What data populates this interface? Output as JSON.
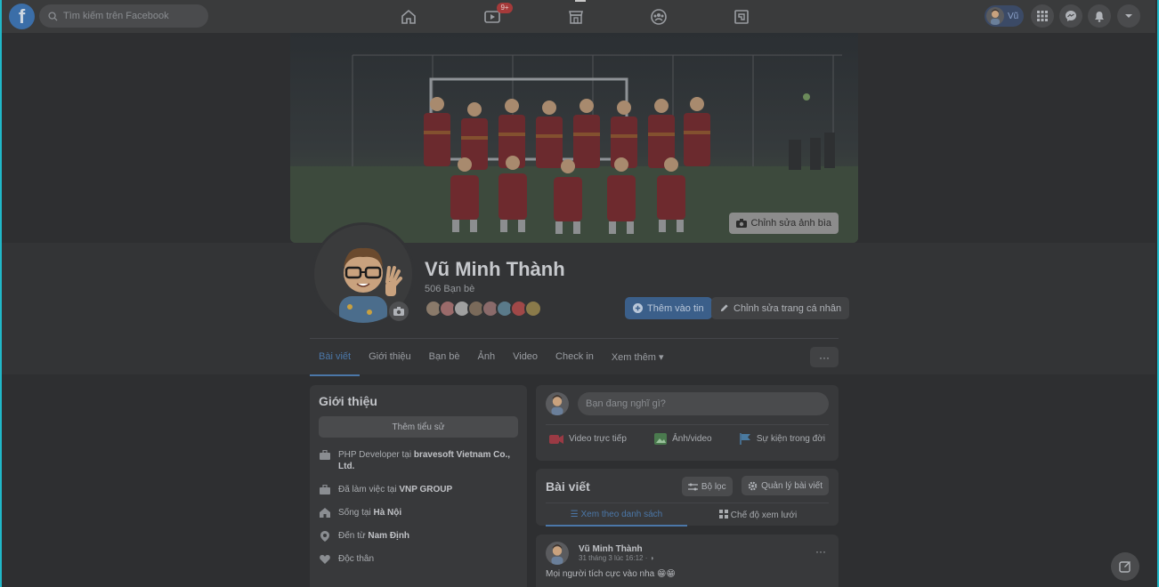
{
  "topbar": {
    "logo": "f",
    "search_placeholder": "Tìm kiếm trên Facebook",
    "watch_badge": "9+",
    "user_short": "Vũ",
    "icons": [
      "home-icon",
      "watch-icon",
      "marketplace-icon",
      "groups-icon",
      "gaming-icon",
      "menu-grid-icon",
      "messenger-icon",
      "notifications-icon",
      "account-caret-icon"
    ]
  },
  "cover": {
    "edit_label": "Chỉnh sửa ảnh bìa"
  },
  "profile": {
    "name": "Vũ Minh Thành",
    "friends_count": "506 Bạn bè",
    "add_story_label": "Thêm vào tin",
    "edit_profile_label": "Chỉnh sửa trang cá nhân"
  },
  "tabs": [
    {
      "label": "Bài viết",
      "active": true
    },
    {
      "label": "Giới thiệu"
    },
    {
      "label": "Bạn bè"
    },
    {
      "label": "Ảnh"
    },
    {
      "label": "Video"
    },
    {
      "label": "Check in"
    },
    {
      "label": "Xem thêm ▾"
    }
  ],
  "more_label": "···",
  "intro": {
    "title": "Giới thiệu",
    "add_bio_label": "Thêm tiểu sử",
    "rows": [
      {
        "icon": "work-icon",
        "prefix": "PHP Developer tại ",
        "bold": "bravesoft Vietnam Co., Ltd."
      },
      {
        "icon": "work-icon",
        "prefix": "Đã làm việc tại ",
        "bold": "VNP GROUP"
      },
      {
        "icon": "home-icon",
        "prefix": "Sống tại ",
        "bold": "Hà Nội"
      },
      {
        "icon": "location-icon",
        "prefix": "Đến từ ",
        "bold": "Nam Định"
      },
      {
        "icon": "heart-icon",
        "prefix": "Độc thân",
        "bold": ""
      }
    ]
  },
  "composer": {
    "placeholder": "Bạn đang nghĩ gì?",
    "live_label": "Video trực tiếp",
    "photo_label": "Ảnh/video",
    "event_label": "Sự kiện trong đời"
  },
  "posts": {
    "title": "Bài viết",
    "filter_label": "Bộ lọc",
    "manage_label": "Quản lý bài viết",
    "list_view_label": "☰ Xem theo danh sách",
    "grid_view_label": "Chế độ xem lưới"
  },
  "post": {
    "author": "Vũ Minh Thành",
    "meta": "31 tháng 3 lúc 16:12 · ◑",
    "text": "Mọi người tích cực vào nha 😁😁",
    "more": "···"
  },
  "colors": {
    "accent": "#4b77a8",
    "badge": "#a53a3a",
    "frame": "#20b8c8"
  }
}
